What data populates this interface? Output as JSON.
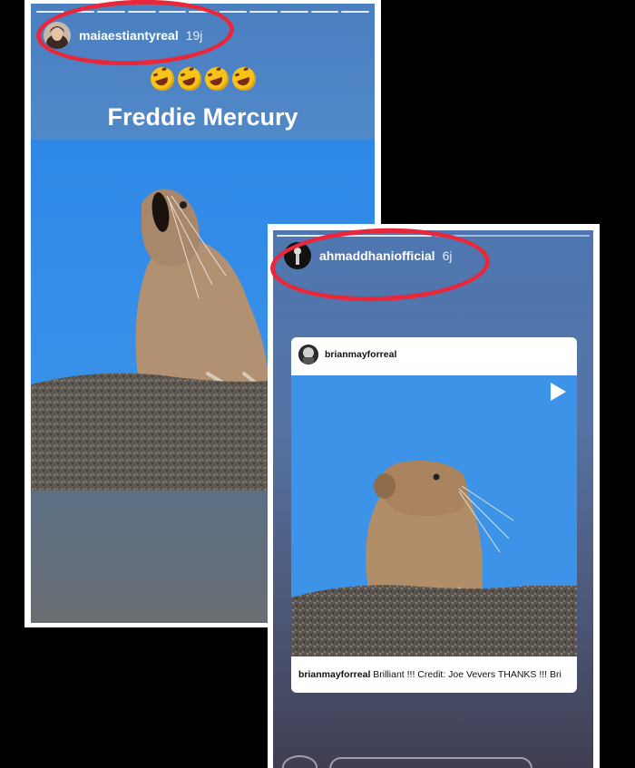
{
  "story1": {
    "username": "maiaestiantyreal",
    "time": "19j",
    "emojis": [
      "rofl-emoji",
      "rofl-emoji",
      "rofl-emoji",
      "rofl-emoji"
    ],
    "caption": "Freddie Mercury"
  },
  "story2": {
    "username": "ahmaddhaniofficial",
    "time": "6j",
    "shared_post": {
      "author": "brianmayforreal",
      "caption_author": "brianmayforreal",
      "caption_text": "Brilliant !!! Credit: Joe Vevers  THANKS !!! Bri"
    }
  },
  "colors": {
    "highlight_circle": "#e8283a",
    "sky": "#2f8be6"
  }
}
